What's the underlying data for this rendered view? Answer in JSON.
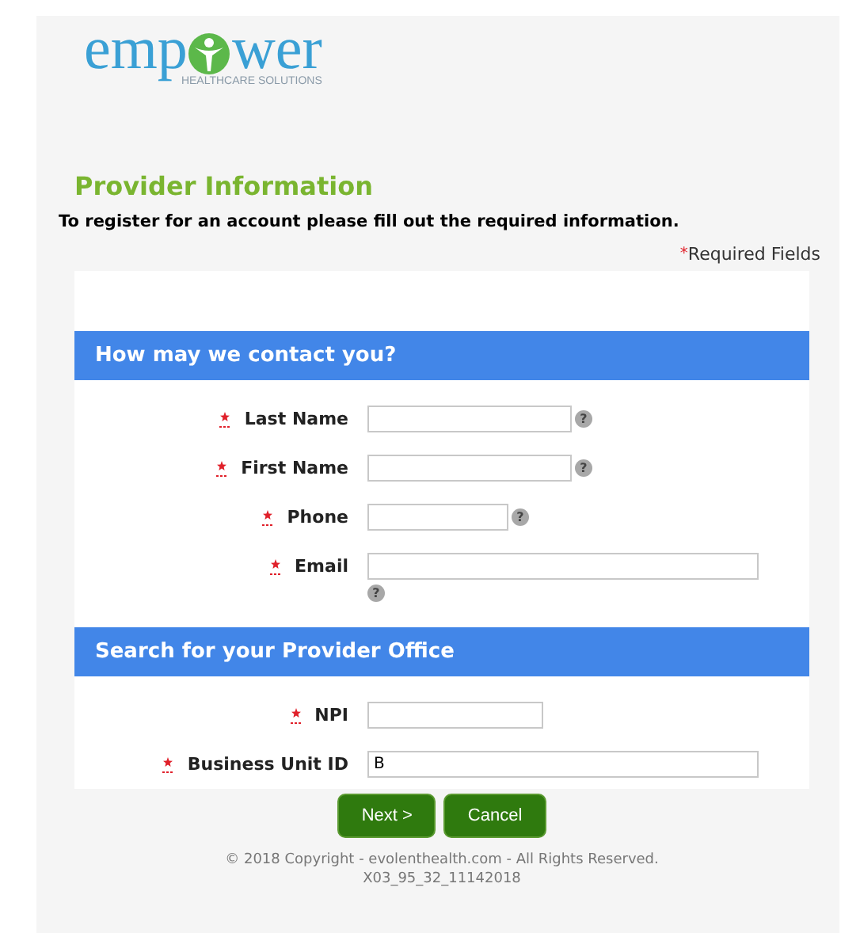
{
  "logo": {
    "text_left": "emp",
    "text_right": "wer",
    "tagline": "HEALTHCARE SOLUTIONS"
  },
  "title": "Provider Information",
  "intro": "To register for an account please fill out the required information.",
  "required_note": {
    "mark": "*",
    "text": "Required Fields"
  },
  "sections": [
    {
      "heading": "How may we contact you?",
      "fields": [
        {
          "label": "Last Name",
          "required": true,
          "kind": "name",
          "help": "?"
        },
        {
          "label": "First Name",
          "required": true,
          "kind": "name",
          "help": "?"
        },
        {
          "label": "Phone",
          "required": true,
          "kind": "phone",
          "help": "?"
        },
        {
          "label": "Email",
          "required": true,
          "kind": "email",
          "help": "?"
        }
      ]
    },
    {
      "heading": "Search for your Provider Office",
      "fields": [
        {
          "label": "NPI",
          "required": true,
          "kind": "npi"
        },
        {
          "label": "Business Unit ID",
          "required": true,
          "kind": "id",
          "value": "B"
        }
      ]
    }
  ],
  "buttons": [
    "Next >",
    "Cancel"
  ],
  "footer": [
    "© 2018 Copyright - evolenthealth.com - All Rights Reserved.",
    "X03_95_32_11142018"
  ]
}
